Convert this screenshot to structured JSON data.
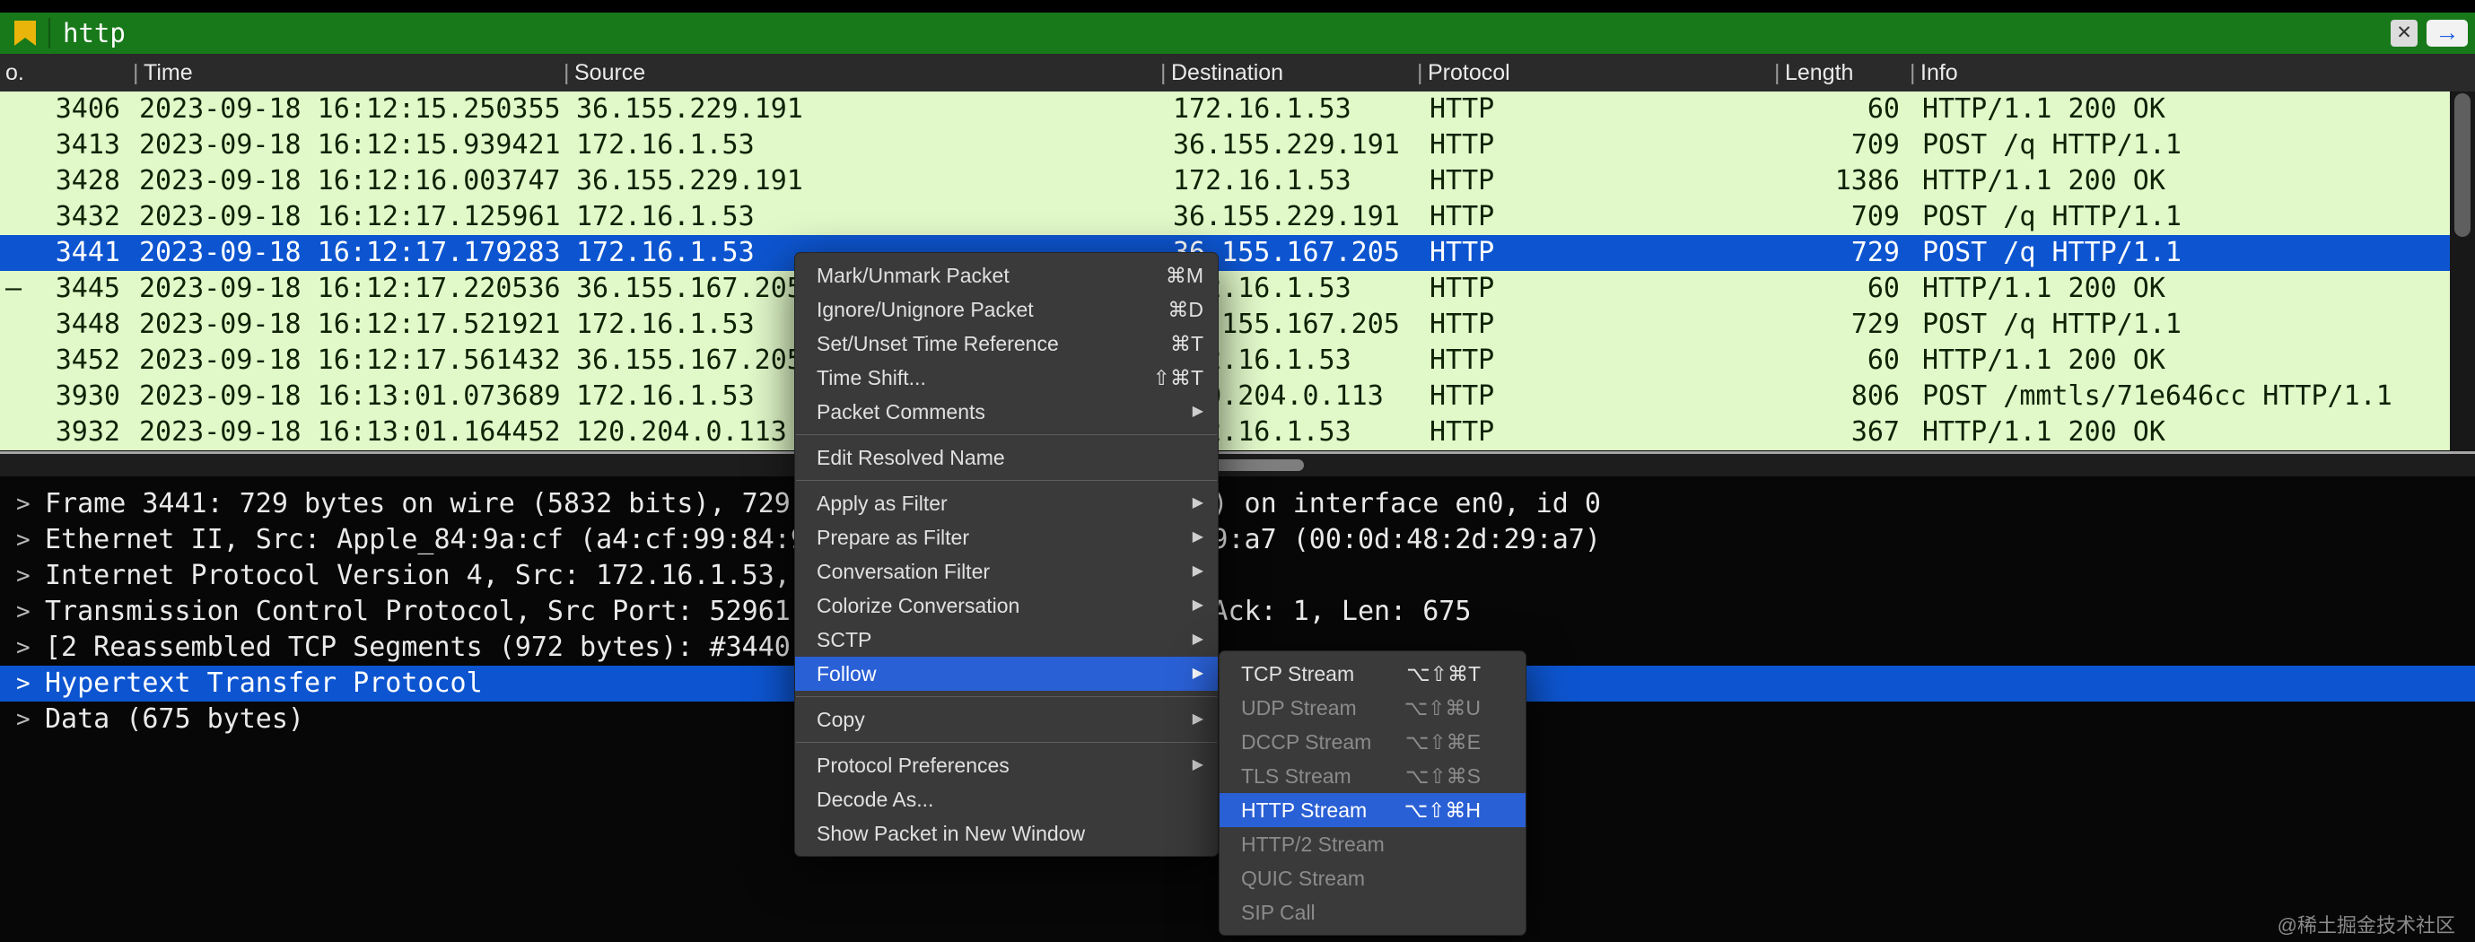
{
  "filter_bar": {
    "filter_text": "http",
    "clear_glyph": "✕",
    "apply_glyph": "→"
  },
  "header_separator": "|",
  "columns": [
    {
      "id": "no",
      "label": "o."
    },
    {
      "id": "time",
      "label": "Time"
    },
    {
      "id": "source",
      "label": "Source"
    },
    {
      "id": "destination",
      "label": "Destination"
    },
    {
      "id": "protocol",
      "label": "Protocol"
    },
    {
      "id": "length",
      "label": "Length"
    },
    {
      "id": "info",
      "label": "Info"
    }
  ],
  "packet_list": {
    "rows": [
      {
        "no": "3406",
        "time": "2023-09-18 16:12:15.250355",
        "source": "36.155.229.191",
        "destination": "172.16.1.53",
        "protocol": "HTTP",
        "length": "60",
        "info": "HTTP/1.1 200 OK",
        "selected": false,
        "marker": ""
      },
      {
        "no": "3413",
        "time": "2023-09-18 16:12:15.939421",
        "source": "172.16.1.53",
        "destination": "36.155.229.191",
        "protocol": "HTTP",
        "length": "709",
        "info": "POST /q HTTP/1.1",
        "selected": false,
        "marker": ""
      },
      {
        "no": "3428",
        "time": "2023-09-18 16:12:16.003747",
        "source": "36.155.229.191",
        "destination": "172.16.1.53",
        "protocol": "HTTP",
        "length": "1386",
        "info": "HTTP/1.1 200 OK",
        "selected": false,
        "marker": ""
      },
      {
        "no": "3432",
        "time": "2023-09-18 16:12:17.125961",
        "source": "172.16.1.53",
        "destination": "36.155.229.191",
        "protocol": "HTTP",
        "length": "709",
        "info": "POST /q HTTP/1.1",
        "selected": false,
        "marker": ""
      },
      {
        "no": "3441",
        "time": "2023-09-18 16:12:17.179283",
        "source": "172.16.1.53",
        "destination": "36.155.167.205",
        "protocol": "HTTP",
        "length": "729",
        "info": "POST /q HTTP/1.1",
        "selected": true,
        "marker": ""
      },
      {
        "no": "3445",
        "time": "2023-09-18 16:12:17.220536",
        "source": "36.155.167.205",
        "destination": "172.16.1.53",
        "protocol": "HTTP",
        "length": "60",
        "info": "HTTP/1.1 200 OK",
        "selected": false,
        "marker": "–"
      },
      {
        "no": "3448",
        "time": "2023-09-18 16:12:17.521921",
        "source": "172.16.1.53",
        "destination": "36.155.167.205",
        "protocol": "HTTP",
        "length": "729",
        "info": "POST /q HTTP/1.1",
        "selected": false,
        "marker": ""
      },
      {
        "no": "3452",
        "time": "2023-09-18 16:12:17.561432",
        "source": "36.155.167.205",
        "destination": "172.16.1.53",
        "protocol": "HTTP",
        "length": "60",
        "info": "HTTP/1.1 200 OK",
        "selected": false,
        "marker": ""
      },
      {
        "no": "3930",
        "time": "2023-09-18 16:13:01.073689",
        "source": "172.16.1.53",
        "destination": "120.204.0.113",
        "protocol": "HTTP",
        "length": "806",
        "info": "POST /mmtls/71e646cc HTTP/1.1",
        "selected": false,
        "marker": ""
      },
      {
        "no": "3932",
        "time": "2023-09-18 16:13:01.164452",
        "source": "120.204.0.113",
        "destination": "172.16.1.53",
        "protocol": "HTTP",
        "length": "367",
        "info": "HTTP/1.1 200 OK",
        "selected": false,
        "marker": ""
      }
    ]
  },
  "detail_pane": {
    "expander_glyph": ">",
    "rows": [
      {
        "text": "Frame 3441: 729 bytes on wire (5832 bits), 729 bytes captured (5832 bits) on interface en0, id 0",
        "selected": false
      },
      {
        "text": "Ethernet II, Src: Apple_84:9a:cf (a4:cf:99:84:9a:cf), Dst: 00:0d:48:2d:29:a7 (00:0d:48:2d:29:a7)",
        "selected": false
      },
      {
        "text": "Internet Protocol Version 4, Src: 172.16.1.53, Dst: 36.155.167.205",
        "selected": false
      },
      {
        "text": "Transmission Control Protocol, Src Port: 52961, Dst Port: 80, Seq: 298, Ack: 1, Len: 675",
        "selected": false
      },
      {
        "text": "[2 Reassembled TCP Segments (972 bytes): #3440(297), #3441(675)]",
        "selected": false
      },
      {
        "text": "Hypertext Transfer Protocol",
        "selected": true
      },
      {
        "text": "Data (675 bytes)",
        "selected": false
      }
    ]
  },
  "context_menu": {
    "arrow_glyph": "▶",
    "items": [
      {
        "label": "Mark/Unmark Packet",
        "shortcut": "⌘M"
      },
      {
        "label": "Ignore/Unignore Packet",
        "shortcut": "⌘D"
      },
      {
        "label": "Set/Unset Time Reference",
        "shortcut": "⌘T"
      },
      {
        "label": "Time Shift...",
        "shortcut": "⇧⌘T"
      },
      {
        "label": "Packet Comments",
        "submenu": true
      },
      {
        "separator": true
      },
      {
        "label": "Edit Resolved Name"
      },
      {
        "separator": true
      },
      {
        "label": "Apply as Filter",
        "submenu": true
      },
      {
        "label": "Prepare as Filter",
        "submenu": true
      },
      {
        "label": "Conversation Filter",
        "submenu": true
      },
      {
        "label": "Colorize Conversation",
        "submenu": true
      },
      {
        "label": "SCTP",
        "submenu": true
      },
      {
        "label": "Follow",
        "submenu": true,
        "highlighted": true
      },
      {
        "separator": true
      },
      {
        "label": "Copy",
        "submenu": true
      },
      {
        "separator": true
      },
      {
        "label": "Protocol Preferences",
        "submenu": true
      },
      {
        "label": "Decode As..."
      },
      {
        "label": "Show Packet in New Window"
      }
    ]
  },
  "follow_submenu": {
    "items": [
      {
        "label": "TCP Stream",
        "shortcut": "⌥⇧⌘T"
      },
      {
        "label": "UDP Stream",
        "shortcut": "⌥⇧⌘U",
        "disabled": true
      },
      {
        "label": "DCCP Stream",
        "shortcut": "⌥⇧⌘E",
        "disabled": true
      },
      {
        "label": "TLS Stream",
        "shortcut": "⌥⇧⌘S",
        "disabled": true
      },
      {
        "label": "HTTP Stream",
        "shortcut": "⌥⇧⌘H",
        "highlighted": true
      },
      {
        "label": "HTTP/2 Stream",
        "disabled": true
      },
      {
        "label": "QUIC Stream",
        "disabled": true
      },
      {
        "label": "SIP Call",
        "disabled": true
      }
    ]
  },
  "watermark": "@稀土掘金技术社区",
  "colors": {
    "filter_green": "#18791a",
    "header_bg": "#2a2a2a",
    "header_text": "#eaeaea",
    "row_green": "#e1f8c9",
    "row_text": "#0e2205",
    "selection_blue": "#0d55d0",
    "menu_bg": "#3a3a3a",
    "menu_text": "#e0e0e0",
    "menu_disabled": "#8b8b8b",
    "menu_highlight": "#2a60d5",
    "detail_bg": "#070707",
    "detail_text": "#eaeaea",
    "scrollbar_track": "#181818",
    "scrollbar_thumb": "#5f5f5f",
    "splitter_gray": "#a6a6a6",
    "apply_arrow_blue": "#1a5fe0",
    "bookmark_yellow": "#e9b50b",
    "watermark_gray": "#8a8a8a"
  }
}
